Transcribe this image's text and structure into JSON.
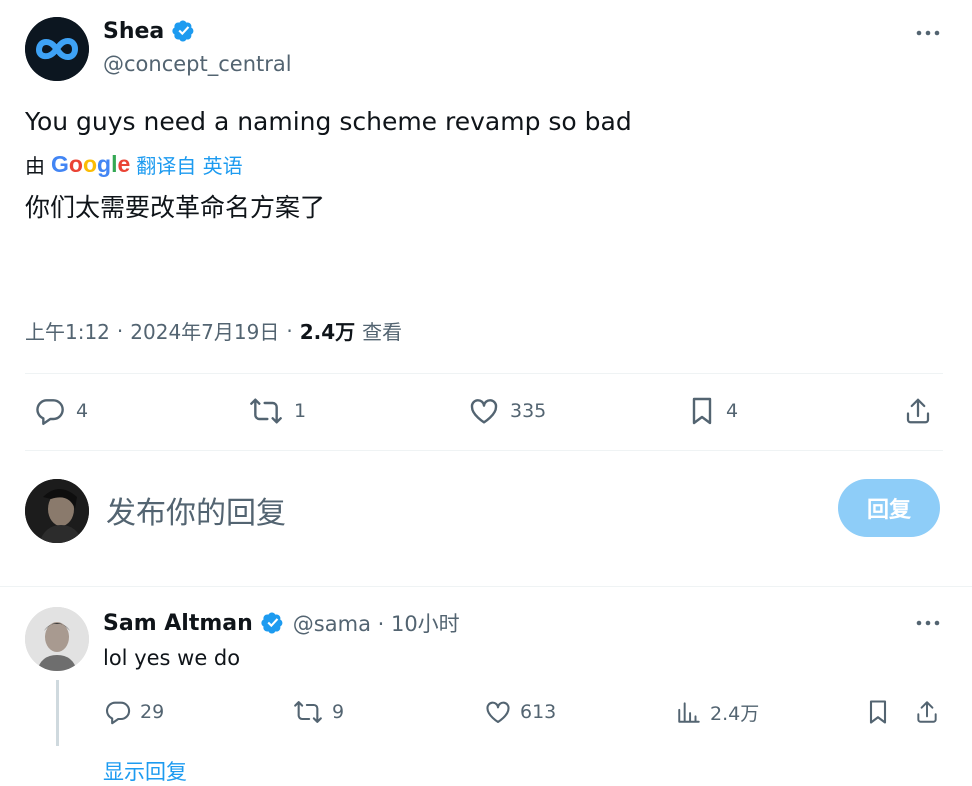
{
  "tweet": {
    "author_name": "Shea",
    "author_handle": "@concept_central",
    "text": "You guys need a naming scheme revamp so bad",
    "translate_prefix": "由",
    "google_letters": [
      "G",
      "o",
      "o",
      "g",
      "l",
      "e"
    ],
    "translate_suffix": "翻译自 英语",
    "translated_text": "你们太需要改革命名方案了",
    "time": "上午1:12",
    "sep": "·",
    "date": "2024年7月19日",
    "views_count": "2.4万",
    "views_label": "查看",
    "stats": {
      "replies": "4",
      "retweets": "1",
      "likes": "335",
      "bookmarks": "4"
    }
  },
  "reply_box": {
    "placeholder": "发布你的回复",
    "button_label": "回复"
  },
  "reply": {
    "author_name": "Sam Altman",
    "handle_time": "@sama · 10小时",
    "text": "lol yes we do",
    "stats": {
      "replies": "29",
      "retweets": "9",
      "likes": "613",
      "views": "2.4万"
    },
    "show_replies": "显示回复"
  },
  "colors": {
    "verified": "#1d9bf0",
    "muted_text": "#536471",
    "reply_button": "#8ecdf8",
    "link": "#1d9bf0"
  },
  "icons": [
    "more-icon",
    "verified-icon",
    "reply-icon",
    "retweet-icon",
    "like-icon",
    "bookmark-icon",
    "share-icon",
    "views-icon"
  ]
}
